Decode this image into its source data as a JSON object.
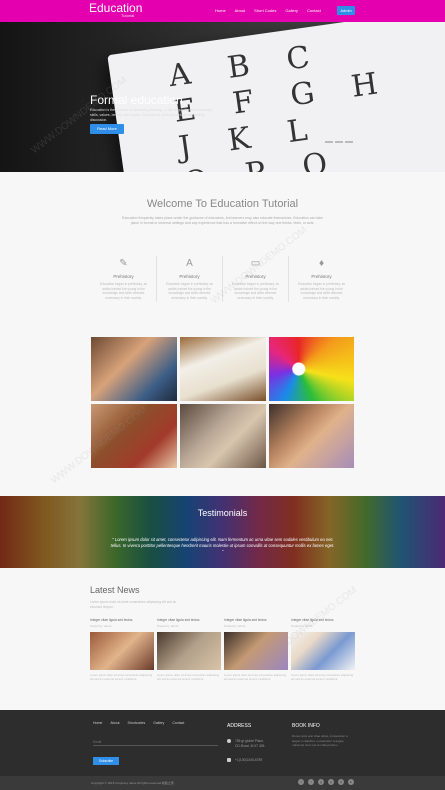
{
  "nav": {
    "logo": "Education",
    "logo_sub": "Tutorial",
    "items": [
      "Home",
      "About",
      "Short Codes",
      "Gallery",
      "Contact"
    ],
    "cta": "Admin",
    "bg_color": "#e400ae"
  },
  "hero": {
    "title": "Formal education",
    "text": "Education is the process of facilitating learning, or the acquisition of knowledge, skills, values, beliefs, and habits. Educational methods include storytelling, discussion.",
    "button": "Read More",
    "letters": [
      "A B C",
      "E F G H",
      "J K L",
      "O P Q"
    ]
  },
  "welcome": {
    "title": "Welcome To Education Tutorial",
    "text": "Education frequently takes place under the guidance of educators, but learners may also educate themselves. Education can take place in formal or informal settings and any experience that has a formative effect on the way one thinks, feels, or acts."
  },
  "features": [
    {
      "icon": "pencil-icon",
      "glyph": "✎",
      "title": "Prehistory",
      "text": "Education began in prehistory, as adults trained the young in the knowledge and skills deemed necessary in their society."
    },
    {
      "icon": "letter-a-icon",
      "glyph": "A",
      "title": "Prehistory",
      "text": "Education began in prehistory, as adults trained the young in the knowledge and skills deemed necessary in their society."
    },
    {
      "icon": "monitor-icon",
      "glyph": "▭",
      "title": "Prehistory",
      "text": "Education began in prehistory, as adults trained the young in the knowledge and skills deemed necessary in their society."
    },
    {
      "icon": "graduation-cap-icon",
      "glyph": "♦",
      "title": "Prehistory",
      "text": "Education began in prehistory, as adults trained the young in the knowledge and skills deemed necessary in their society."
    }
  ],
  "testimonials": {
    "title": "Testimonials",
    "quote": "\" Lorem ipsum dolor sit amet, consectetur adipiscing elit. Nam fermentum ac urna vitae sem sodales vestibulum eu nec tellus. In viverra porttitor pellentesque hendrerit mauris molestie ut ipsum convallis at consequuntur mollis ex fames eget. \""
  },
  "news": {
    "title": "Latest News",
    "subtitle": "Lorem ipsum dolor sit amet consectetur adipiscing elit sed do eiusmod tempor.",
    "items": [
      {
        "title": "Integer vitae ligula sed lectus",
        "meta": "Posted by: admin",
        "text": "Lorem ipsum dolor sit amet consectetur adipiscing elit sed do eiusmod tempor incididunt."
      },
      {
        "title": "Integer vitae ligula sed lectus",
        "meta": "Posted by: admin",
        "text": "Lorem ipsum dolor sit amet consectetur adipiscing elit sed do eiusmod tempor incididunt."
      },
      {
        "title": "Integer vitae ligula sed lectus",
        "meta": "Posted by: admin",
        "text": "Lorem ipsum dolor sit amet consectetur adipiscing elit sed do eiusmod tempor incididunt."
      },
      {
        "title": "Integer vitae ligula sed lectus",
        "meta": "Posted by: admin",
        "text": "Lorem ipsum dolor sit amet consectetur adipiscing elit sed do eiusmod tempor incididunt."
      }
    ]
  },
  "footer": {
    "menu": [
      "Home",
      "About",
      "Shortcodes",
      "Gallery",
      "Contact"
    ],
    "email_placeholder": "Email",
    "subscribe": "Subscribe",
    "address_heading": "ADDRESS",
    "address_lines": [
      "756 gt globel Place,",
      "CD-Road, M 07 435."
    ],
    "phone": "+1(100)2345-6789",
    "info_heading": "BOOK INFO",
    "info_text": "Donec quis erat vitae tellus, consectetur a augue in dapibus, consectetur a augue maximus nunc est et nulla pretium.",
    "copyright": "Copyright © 2016 Company name All rights reserved.模板之家",
    "social": [
      "f",
      "t",
      "g",
      "p",
      "d",
      "in"
    ]
  },
  "watermark": "WWW.DOWNDEMO.COM"
}
